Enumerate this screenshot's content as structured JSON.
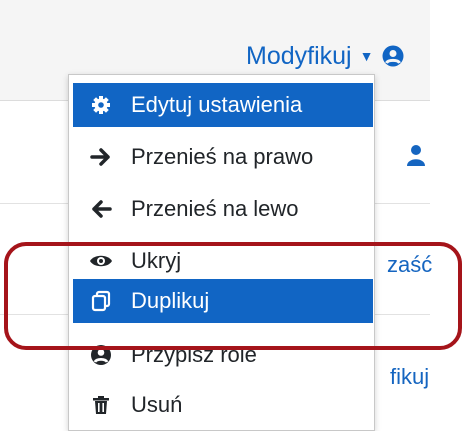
{
  "header": {
    "menu_label": "Modyfikuj",
    "caret": "▼"
  },
  "background": {
    "partial_text_1": "zaść",
    "partial_text_2": "fikuj"
  },
  "menu": {
    "items": [
      {
        "label": "Edytuj ustawienia",
        "icon": "gear-icon",
        "active": true
      },
      {
        "label": "Przenieś na prawo",
        "icon": "arrow-right-icon",
        "active": false
      },
      {
        "label": "Przenieś na lewo",
        "icon": "arrow-left-icon",
        "active": false
      },
      {
        "label": "Ukryj",
        "icon": "eye-icon",
        "active": false
      },
      {
        "label": "Duplikuj",
        "icon": "copy-icon",
        "active": true
      },
      {
        "label": "Przypisz role",
        "icon": "user-circle-icon",
        "active": false
      },
      {
        "label": "Usuń",
        "icon": "trash-icon",
        "active": false
      }
    ]
  },
  "colors": {
    "accent": "#1165c4",
    "annotation": "#a5141a"
  }
}
